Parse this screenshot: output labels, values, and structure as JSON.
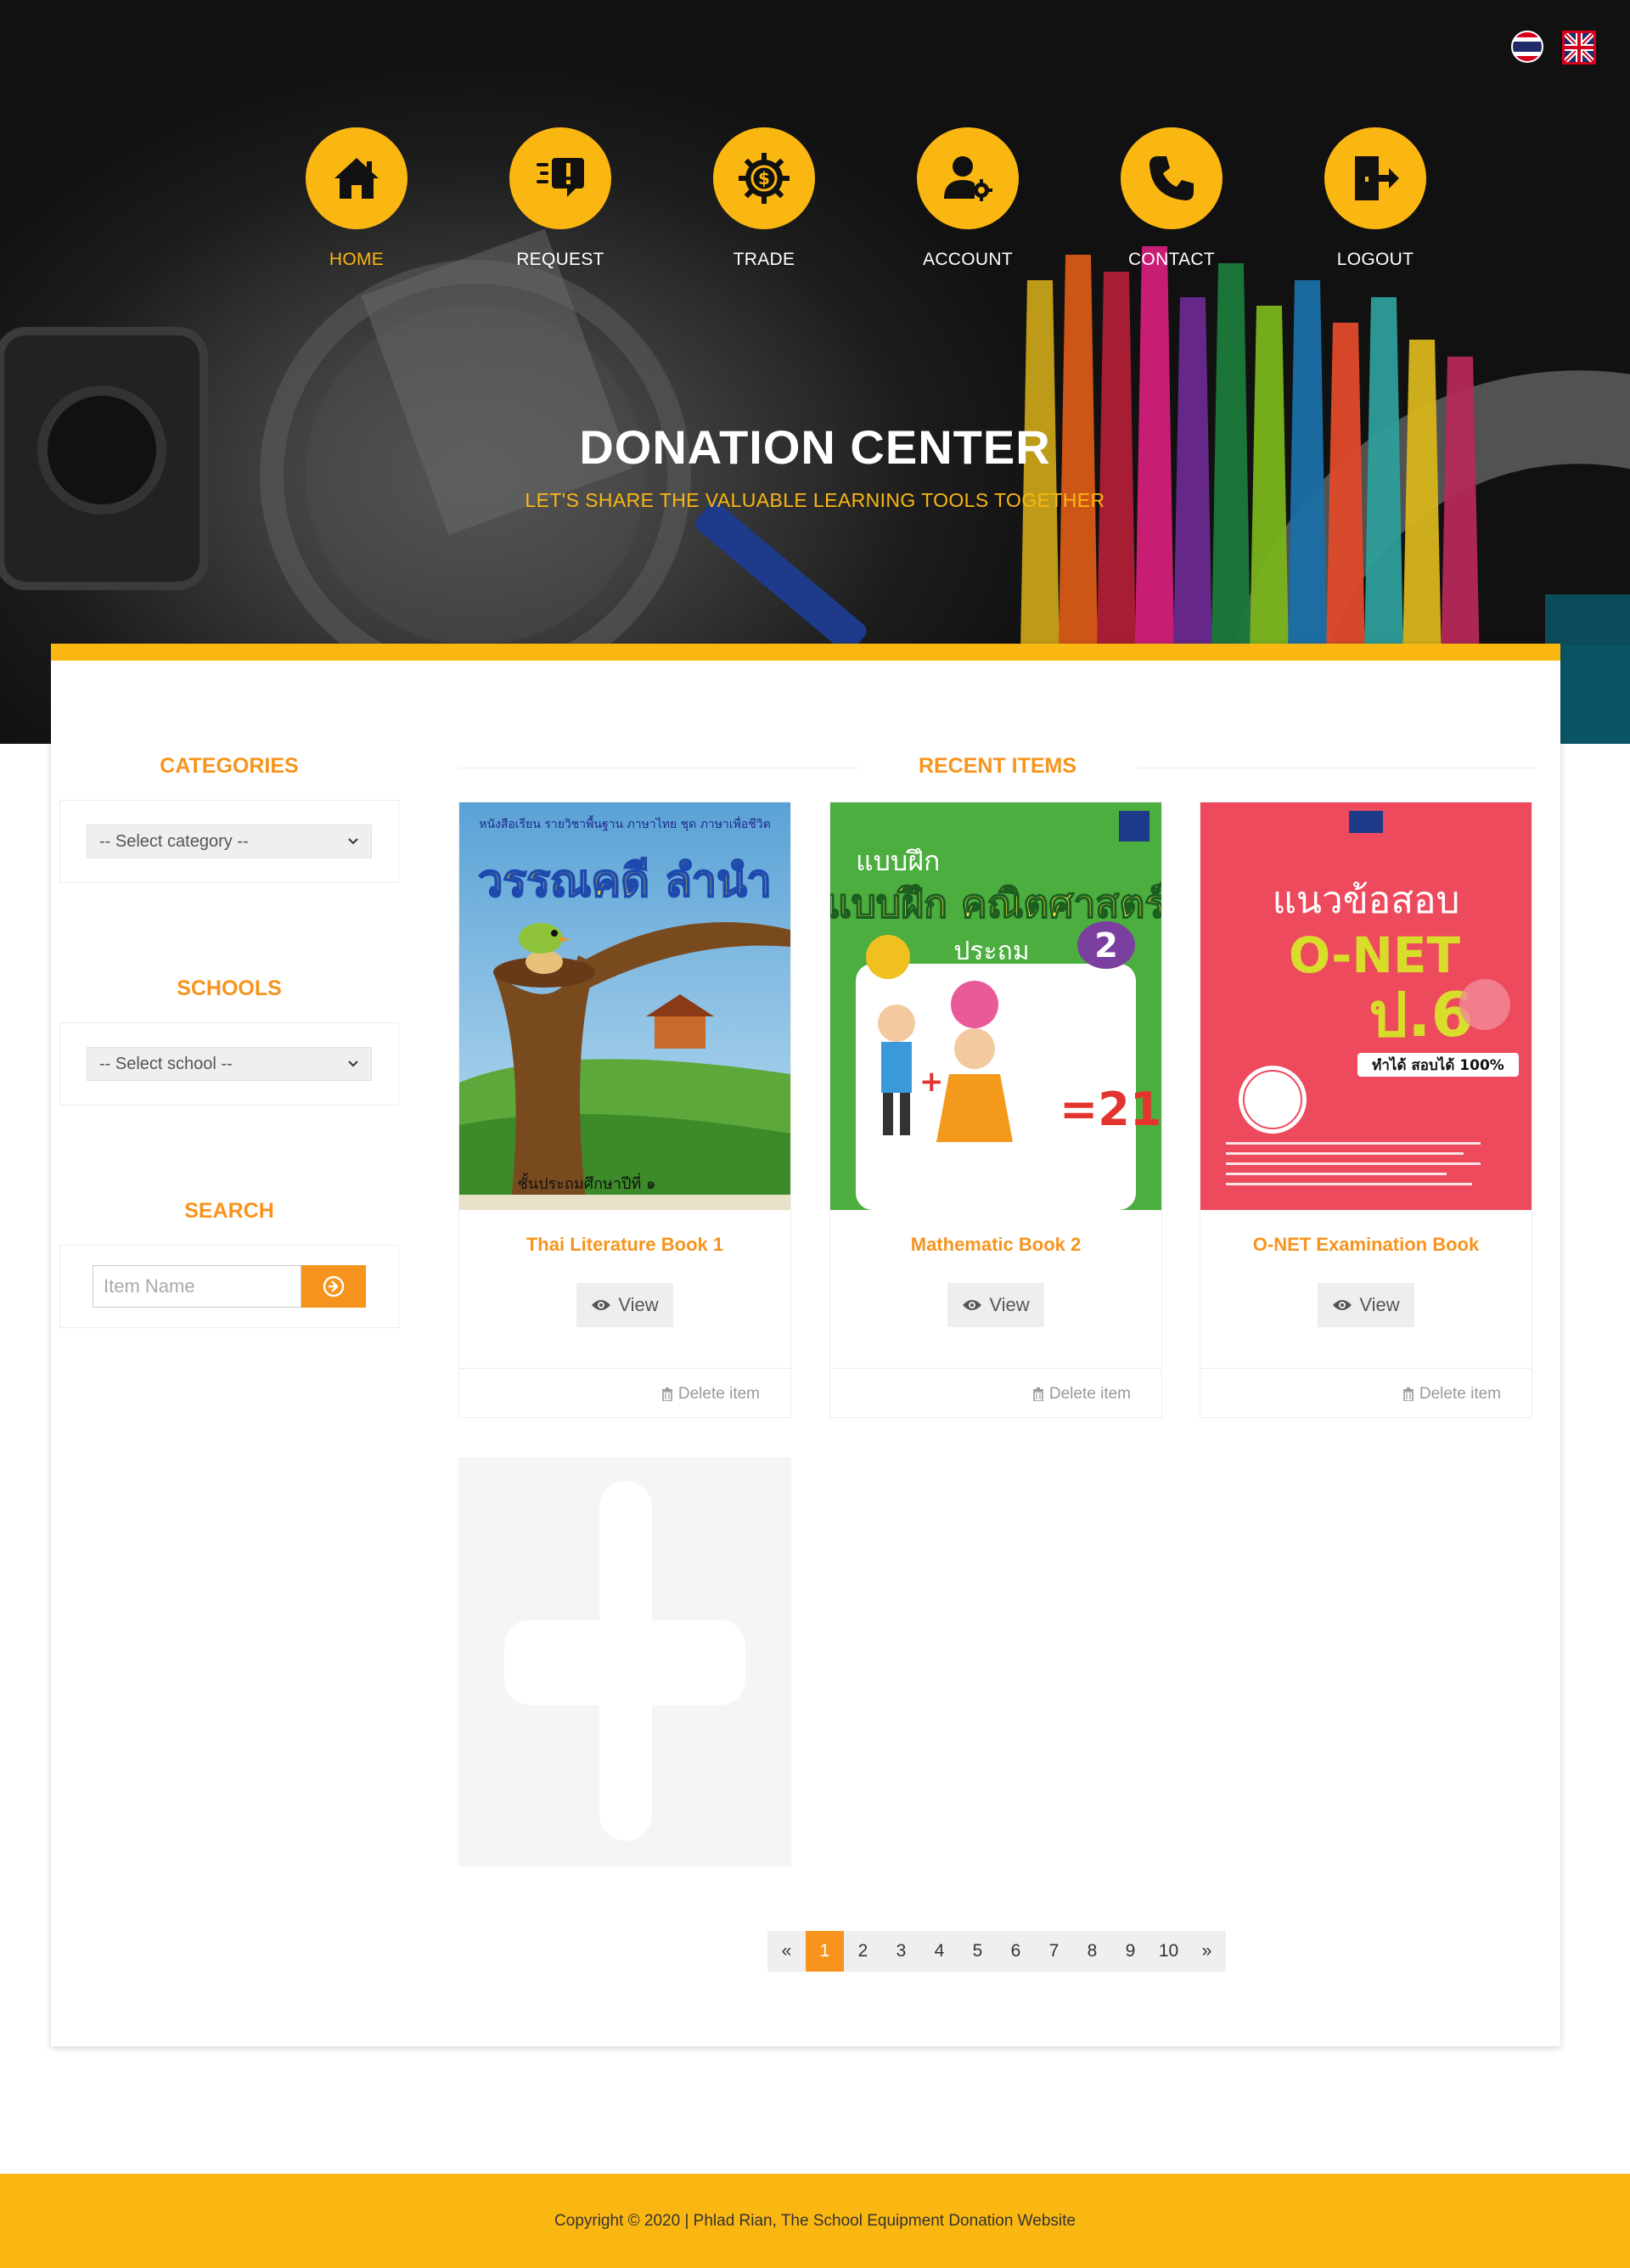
{
  "languages": {
    "thai": "Thai flag",
    "english": "UK flag"
  },
  "nav": [
    {
      "label": "HOME",
      "icon": "home-icon",
      "active": true
    },
    {
      "label": "REQUEST",
      "icon": "request-icon"
    },
    {
      "label": "TRADE",
      "icon": "trade-icon"
    },
    {
      "label": "ACCOUNT",
      "icon": "account-icon"
    },
    {
      "label": "CONTACT",
      "icon": "phone-icon"
    },
    {
      "label": "LOGOUT",
      "icon": "logout-icon"
    }
  ],
  "hero": {
    "title": "DONATION CENTER",
    "subtitle": "LET'S SHARE THE VALUABLE LEARNING TOOLS TOGETHER"
  },
  "sidebar": {
    "categories_title": "CATEGORIES",
    "category_select": "-- Select category --",
    "schools_title": "SCHOOLS",
    "school_select": "-- Select school --",
    "search_title": "SEARCH",
    "search_placeholder": "Item Name"
  },
  "recent": {
    "title": "RECENT ITEMS",
    "items": [
      {
        "name": "Thai Literature Book 1",
        "view": "View",
        "delete": "Delete item",
        "cover_title": "วรรณคดี ลำนำ",
        "cover_header": "หนังสือเรียน รายวิชาพื้นฐาน ภาษาไทย ชุด ภาษาเพื่อชีวิต",
        "cover_footer": "ชั้นประถมศึกษาปีที่ ๑"
      },
      {
        "name": "Mathematic Book 2",
        "view": "View",
        "delete": "Delete item",
        "cover_title": "แบบฝึก คณิตศาสตร์",
        "cover_sub": "ประถม",
        "cover_num": "2",
        "cover_eq": "=21"
      },
      {
        "name": "O-NET Examination Book",
        "view": "View",
        "delete": "Delete item",
        "cover_title": "แนวข้อสอบ",
        "cover_big": "O-NET",
        "cover_grade": "ป.6",
        "cover_tag": "ทำได้ สอบได้ 100%"
      }
    ]
  },
  "pagination": {
    "prev": "«",
    "pages": [
      "1",
      "2",
      "3",
      "4",
      "5",
      "6",
      "7",
      "8",
      "9",
      "10"
    ],
    "next": "»",
    "current": "1"
  },
  "footer": {
    "text": "Copyright © 2020 | Phlad Rian, The School Equipment Donation Website"
  },
  "colors": {
    "accent": "#fbb711",
    "orange": "#f7941d"
  }
}
